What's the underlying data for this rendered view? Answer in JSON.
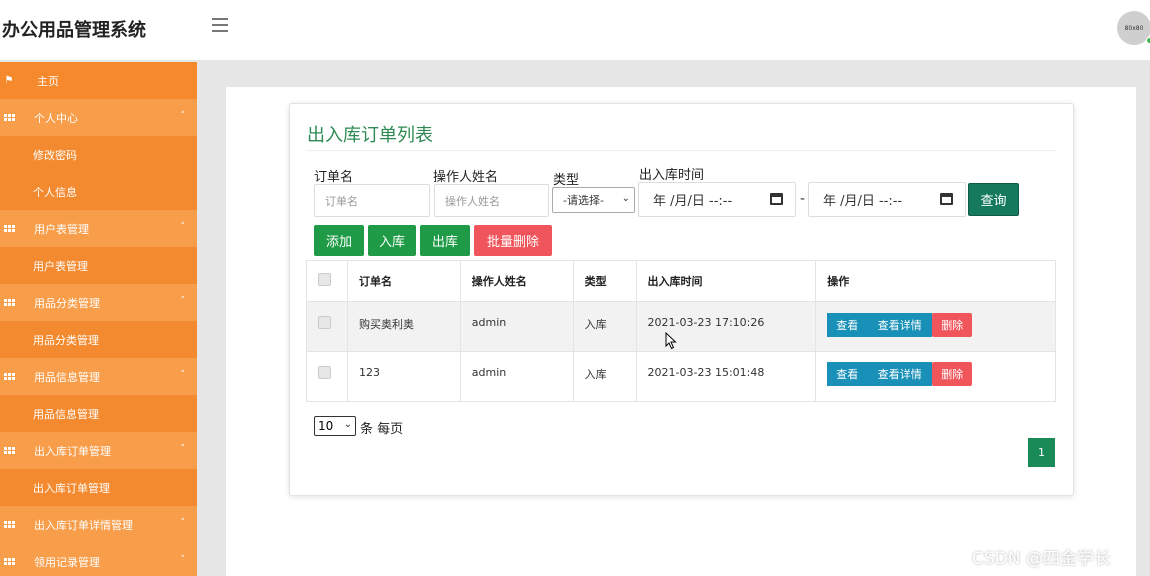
{
  "header": {
    "app_title": "办公用品管理系统",
    "avatar_label": "80x80"
  },
  "sidebar": {
    "items": [
      {
        "label": "主页",
        "icon": "flag-icon",
        "kind": "top"
      },
      {
        "label": "个人中心",
        "icon": "grid-icon",
        "kind": "group",
        "caret": "˄"
      },
      {
        "label": "修改密码",
        "kind": "sub"
      },
      {
        "label": "个人信息",
        "kind": "sub"
      },
      {
        "label": "用户表管理",
        "icon": "grid-icon",
        "kind": "group",
        "caret": "˄"
      },
      {
        "label": "用户表管理",
        "kind": "sub"
      },
      {
        "label": "用品分类管理",
        "icon": "grid-icon",
        "kind": "group",
        "caret": "˄"
      },
      {
        "label": "用品分类管理",
        "kind": "sub"
      },
      {
        "label": "用品信息管理",
        "icon": "grid-icon",
        "kind": "group",
        "caret": "˄"
      },
      {
        "label": "用品信息管理",
        "kind": "sub"
      },
      {
        "label": "出入库订单管理",
        "icon": "grid-icon",
        "kind": "group",
        "caret": "˄"
      },
      {
        "label": "出入库订单管理",
        "kind": "sub"
      },
      {
        "label": "出入库订单详情管理",
        "icon": "grid-icon",
        "kind": "group",
        "caret": "˅"
      },
      {
        "label": "领用记录管理",
        "icon": "grid-icon",
        "kind": "group",
        "caret": "˅"
      }
    ]
  },
  "main": {
    "title": "出入库订单列表",
    "filters": {
      "order_name_label": "订单名",
      "order_name_placeholder": "订单名",
      "operator_label": "操作人姓名",
      "operator_placeholder": "操作人姓名",
      "type_label": "类型",
      "type_selected": "-请选择-",
      "time_label": "出入库时间",
      "date_start": "年 /月/日 --:--",
      "date_end": "年 /月/日 --:--",
      "dash": "-",
      "search_button": "查询"
    },
    "actions": {
      "add": "添加",
      "stock_in": "入库",
      "stock_out": "出库",
      "batch_delete": "批量删除"
    },
    "table": {
      "columns": [
        "订单名",
        "操作人姓名",
        "类型",
        "出入库时间",
        "操作"
      ],
      "rows": [
        {
          "name": "购买奥利奥",
          "operator": "admin",
          "type": "入库",
          "time": "2021-03-23 17:10:26"
        },
        {
          "name": "123",
          "operator": "admin",
          "type": "入库",
          "time": "2021-03-23 15:01:48"
        }
      ],
      "row_actions": {
        "view": "查看",
        "detail": "查看详情",
        "delete": "删除"
      }
    },
    "pager": {
      "page_size": "10",
      "per_page_text": "条 每页",
      "current_page": "1"
    }
  },
  "watermark": "CSDN @四金学长",
  "colors": {
    "sidebar": "#f6892c",
    "accent_green": "#1f9b47",
    "danger": "#f1555c",
    "info": "#1890b8"
  }
}
